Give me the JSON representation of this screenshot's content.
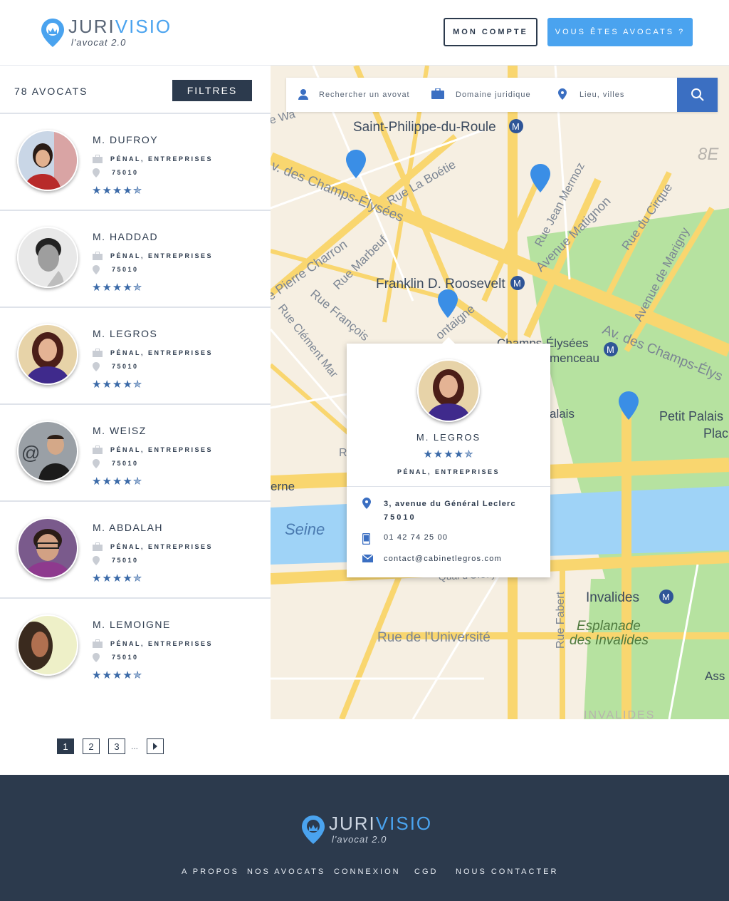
{
  "header": {
    "logo": {
      "brand_a": "JURI",
      "brand_b": "VISIO",
      "tagline": "l'avocat 2.0"
    },
    "account_label": "MON COMPTE",
    "lawyer_label": "VOUS ÊTES AVOCATS ?"
  },
  "list": {
    "count": "78 AVOCATS",
    "filters_label": "FILTRES",
    "items": [
      {
        "name": "M. DUFROY",
        "domain": "PÉNAL, ENTREPRISES",
        "postcode": "75010",
        "stars": "★★★★✯"
      },
      {
        "name": "M. HADDAD",
        "domain": "PÉNAL, ENTREPRISES",
        "postcode": "75010",
        "stars": "★★★★✯"
      },
      {
        "name": "M. LEGROS",
        "domain": "PÉNAL, ENTREPRISES",
        "postcode": "75010",
        "stars": "★★★★✯"
      },
      {
        "name": "M. WEISZ",
        "domain": "PÉNAL, ENTREPRISES",
        "postcode": "75010",
        "stars": "★★★★✯"
      },
      {
        "name": "M. ABDALAH",
        "domain": "PÉNAL, ENTREPRISES",
        "postcode": "75010",
        "stars": "★★★★✯"
      },
      {
        "name": "M. LEMOIGNE",
        "domain": "PÉNAL, ENTREPRISES",
        "postcode": "75010",
        "stars": "★★★★✯"
      }
    ]
  },
  "search": {
    "name_placeholder": "Rechercher un avovat",
    "domain_placeholder": "Domaine juridique",
    "place_placeholder": "Lieu, villes"
  },
  "map": {
    "labels": {
      "saint_philippe": "Saint-Philippe-du-Roule",
      "franklin": "Franklin D. Roosevelt",
      "champs_elysees_station": "Champs-Élysées",
      "clemenceau": "menceau",
      "invalides": "Invalides",
      "esplanade_1": "Esplanade",
      "esplanade_2": "des Invalides",
      "seine": "Seine",
      "petit_palais": "Petit Palais",
      "plac": "Plac",
      "rue_universite": "Rue de l'Université",
      "rue_fabert": "Rue Fabert",
      "rue_boetie": "Rue La Boétie",
      "rue_mermoz": "Rue Jean Mermoz",
      "av_matignon": "Avenue Matignon",
      "rue_cirque": "Rue du Cirque",
      "av_marigny": "Avenue de Marigny",
      "champs_1": "v. des Champs-Élysées",
      "champs_2": "Av. des Champs-Élys",
      "rue_charron": "e Pierre Charron",
      "rue_marbeuf": "Rue Marbeuf",
      "rue_francois": "Rue François",
      "rue_clement": "Rue Clément Mar",
      "montaigne": "ontaigne",
      "arrondissement": "8E",
      "invalides_bottom": "INVALIDES",
      "erne": "erne",
      "alais": "alais",
      "ass": "Ass",
      "quai": "Quai d'Orsay",
      "rue_wa": "e Wa",
      "r_left": "R"
    }
  },
  "popup": {
    "name": "M. LEGROS",
    "stars": "★★★★✯",
    "domain": "PÉNAL, ENTREPRISES",
    "address": "3, avenue du Général Leclerc",
    "postcode": "75010",
    "phone": "01 42 74 25 00",
    "email": "contact@cabinetlegros.com"
  },
  "pagination": {
    "pages": [
      "1",
      "2",
      "3"
    ],
    "ellipsis": "..."
  },
  "footer": {
    "logo": {
      "brand_a": "JURI",
      "brand_b": "VISIO",
      "tagline": "l'avocat 2.0"
    },
    "nav": [
      "A PROPOS",
      "NOS AVOCATS",
      "CONNEXION",
      "CGD",
      "NOUS CONTACTER"
    ]
  },
  "colors": {
    "accent": "#4aa3ef",
    "dark": "#2c3a4d",
    "search_button": "#3b6fc2",
    "stars": "#3b6aa8",
    "map_park": "#b6e2a0",
    "map_water": "#9fd3f7",
    "map_road": "#f9d66f"
  }
}
